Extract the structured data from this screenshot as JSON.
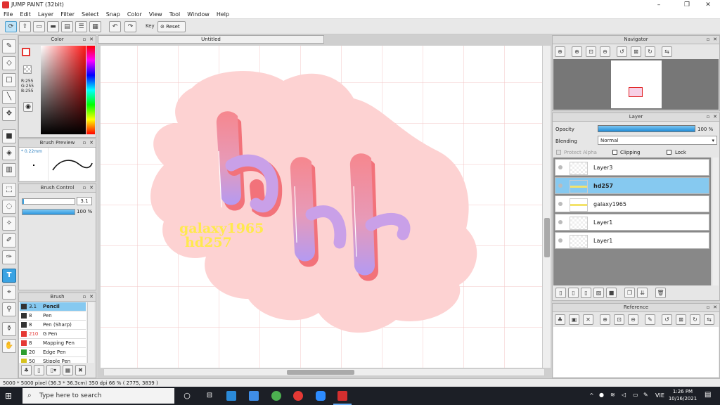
{
  "window": {
    "title": "JUMP PAINT (32bit)",
    "minimize": "–",
    "restore": "❐",
    "close": "✕"
  },
  "menu": [
    "File",
    "Edit",
    "Layer",
    "Filter",
    "Select",
    "Snap",
    "Color",
    "View",
    "Tool",
    "Window",
    "Help"
  ],
  "toolbar": {
    "key_label": "Key",
    "reset_label": "Reset"
  },
  "color_panel": {
    "title": "Color",
    "r": "R:255",
    "g": "G:255",
    "b": "B:255",
    "accent": "#e53935"
  },
  "brush_preview": {
    "title": "Brush Preview",
    "size": "* 0.22mm"
  },
  "brush_control": {
    "title": "Brush Control",
    "size_value": "3.1",
    "opacity_value": "100 %"
  },
  "brush_panel": {
    "title": "Brush",
    "items": [
      {
        "size": "3.1",
        "name": "Pencil",
        "color": "#333333"
      },
      {
        "size": "8",
        "name": "Pen",
        "color": "#333333"
      },
      {
        "size": "8",
        "name": "Pen (Sharp)",
        "color": "#333333"
      },
      {
        "size": "210",
        "name": "G Pen",
        "color": "#e53935"
      },
      {
        "size": "8",
        "name": "Mapping Pen",
        "color": "#e53935"
      },
      {
        "size": "20",
        "name": "Edge Pen",
        "color": "#2e9e2e"
      },
      {
        "size": "50",
        "name": "Stipple Pen",
        "color": "#d6c21e"
      }
    ]
  },
  "document": {
    "tab": "Untitled",
    "text1": "galaxy1965",
    "text2": "hd257"
  },
  "navigator": {
    "title": "Navigator"
  },
  "layer_panel": {
    "title": "Layer",
    "opacity_label": "Opacity",
    "opacity_value": "100 %",
    "blending_label": "Blending",
    "blending_value": "Normal",
    "protect_alpha": "Protect Alpha",
    "clipping": "Clipping",
    "lock": "Lock",
    "layers": [
      {
        "name": "Layer3",
        "selected": false
      },
      {
        "name": "hd257",
        "selected": true
      },
      {
        "name": "galaxy1965",
        "selected": false
      },
      {
        "name": "Layer1",
        "selected": false
      },
      {
        "name": "Layer1",
        "selected": false
      }
    ]
  },
  "reference": {
    "title": "Reference"
  },
  "status": "5000 * 5000 pixel  (36.3 * 36.3cm)  350 dpi  66 %  ( 2775, 3839 )",
  "taskbar": {
    "search_placeholder": "Type here to search",
    "time": "1:26 PM",
    "date": "10/16/2021",
    "lang": "VIE"
  }
}
